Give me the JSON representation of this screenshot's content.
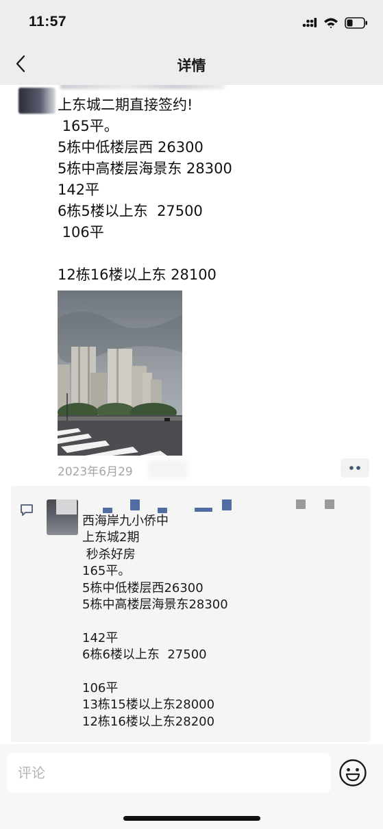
{
  "status_bar": {
    "time": "11:57"
  },
  "nav": {
    "title": "详情"
  },
  "post": {
    "text": "上东城二期直接签约!\n 165平。\n5栋中低楼层西 26300\n5栋中高楼层海景东 28300\n142平\n6栋5楼以上东  27500\n 106平\n\n12栋16楼以上东 28100",
    "date": "2023年6月29"
  },
  "comment": {
    "text": "西海岸九小侨中\n上东城2期\n 秒杀好房\n165平。\n5栋中低楼层西26300\n5栋中高楼层海景东28300\n\n142平\n6栋6楼以上东  27500\n\n106平\n13栋15楼以上东28000\n12栋16楼以上东28200"
  },
  "input": {
    "placeholder": "评论"
  },
  "colors": {
    "bar_bg": "#ededed",
    "comment_bg": "#f5f5f5",
    "name_link": "#3f5e9b",
    "date_gray": "#a5a5a5"
  }
}
